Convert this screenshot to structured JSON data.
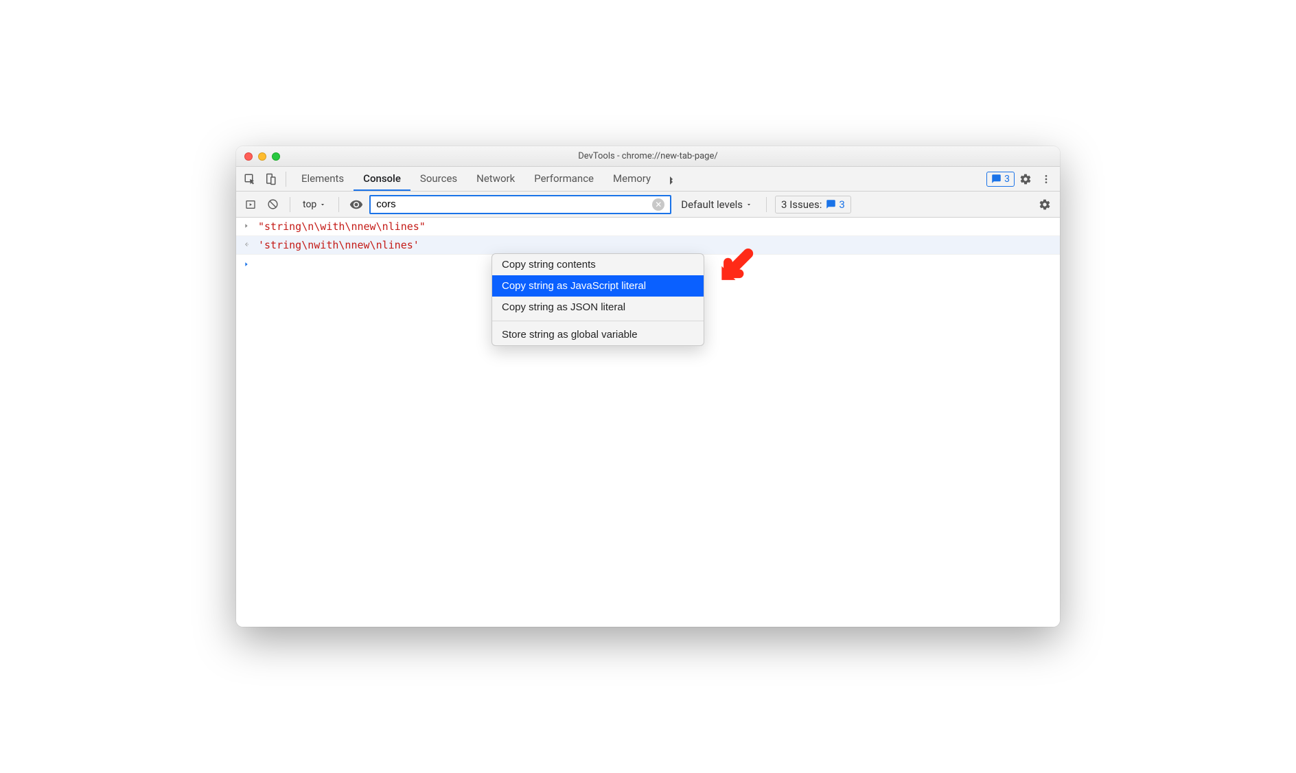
{
  "window": {
    "title": "DevTools - chrome://new-tab-page/"
  },
  "tabs": {
    "items": [
      {
        "label": "Elements"
      },
      {
        "label": "Console"
      },
      {
        "label": "Sources"
      },
      {
        "label": "Network"
      },
      {
        "label": "Performance"
      },
      {
        "label": "Memory"
      }
    ],
    "active_index": 1,
    "badge_count": "3"
  },
  "toolbar": {
    "context": "top",
    "filter_value": "cors",
    "levels": "Default levels",
    "issues_label": "3 Issues:",
    "issues_count": "3"
  },
  "console": {
    "lines": [
      {
        "kind": "input",
        "text": "\"string\\n\\with\\nnew\\nlines\""
      },
      {
        "kind": "output",
        "text": "'string\\nwith\\nnew\\nlines'"
      }
    ]
  },
  "context_menu": {
    "items": [
      {
        "label": "Copy string contents",
        "highlight": false
      },
      {
        "label": "Copy string as JavaScript literal",
        "highlight": true
      },
      {
        "label": "Copy string as JSON literal",
        "highlight": false
      }
    ],
    "items2": [
      {
        "label": "Store string as global variable",
        "highlight": false
      }
    ]
  }
}
